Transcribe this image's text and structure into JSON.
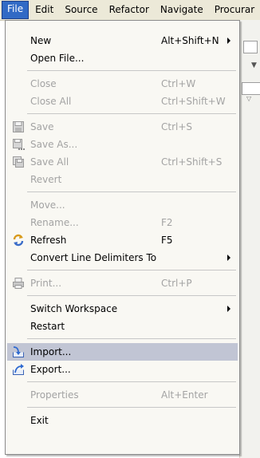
{
  "menubar": {
    "items": [
      "File",
      "Edit",
      "Source",
      "Refactor",
      "Navigate",
      "Procurar"
    ]
  },
  "menu": {
    "items": [
      {
        "label": "New",
        "shortcut": "Alt+Shift+N",
        "submenu": true,
        "enabled": true
      },
      {
        "label": "Open File...",
        "shortcut": "",
        "enabled": true
      },
      {
        "label": "Close",
        "shortcut": "Ctrl+W",
        "enabled": false
      },
      {
        "label": "Close All",
        "shortcut": "Ctrl+Shift+W",
        "enabled": false
      },
      {
        "label": "Save",
        "shortcut": "Ctrl+S",
        "enabled": false,
        "icon": "save-icon"
      },
      {
        "label": "Save As...",
        "shortcut": "",
        "enabled": false,
        "icon": "save-as-icon"
      },
      {
        "label": "Save All",
        "shortcut": "Ctrl+Shift+S",
        "enabled": false,
        "icon": "save-all-icon"
      },
      {
        "label": "Revert",
        "shortcut": "",
        "enabled": false
      },
      {
        "label": "Move...",
        "shortcut": "",
        "enabled": false
      },
      {
        "label": "Rename...",
        "shortcut": "F2",
        "enabled": false
      },
      {
        "label": "Refresh",
        "shortcut": "F5",
        "enabled": true,
        "icon": "refresh-icon"
      },
      {
        "label": "Convert Line Delimiters To",
        "shortcut": "",
        "submenu": true,
        "enabled": true
      },
      {
        "label": "Print...",
        "shortcut": "Ctrl+P",
        "enabled": false,
        "icon": "print-icon"
      },
      {
        "label": "Switch Workspace",
        "shortcut": "",
        "submenu": true,
        "enabled": true
      },
      {
        "label": "Restart",
        "shortcut": "",
        "enabled": true
      },
      {
        "label": "Import...",
        "shortcut": "",
        "enabled": true,
        "highlighted": true,
        "icon": "import-icon"
      },
      {
        "label": "Export...",
        "shortcut": "",
        "enabled": true,
        "icon": "export-icon"
      },
      {
        "label": "Properties",
        "shortcut": "Alt+Enter",
        "enabled": false
      },
      {
        "label": "Exit",
        "shortcut": "",
        "enabled": true
      }
    ]
  },
  "colors": {
    "highlight": "#c1c5d4",
    "active_menu": "#316ac5",
    "disabled_text": "#a3a3a3"
  }
}
